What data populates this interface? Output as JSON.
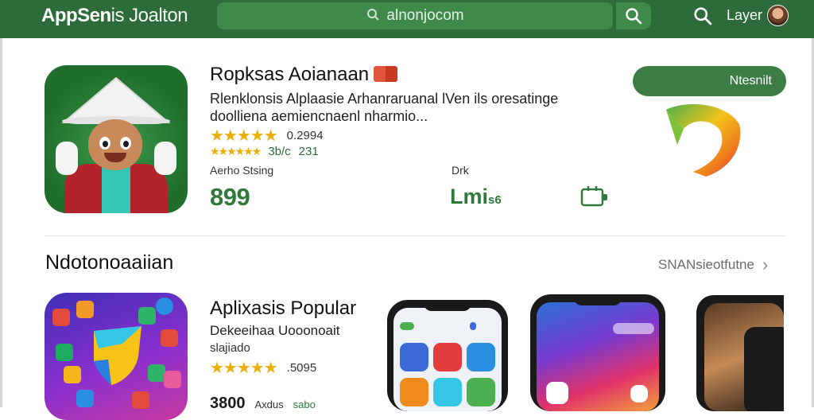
{
  "header": {
    "logo_bold": "AppSen",
    "logo_rest": "is Joalton",
    "search_text": "alnonjoc",
    "search_suffix": "om",
    "user_label": "Layer"
  },
  "featured": {
    "title": "Ropksas Aoianaan",
    "description": "Rlenklonsis Alplaasie Arhanraruanal lVen ils oresatinge doolliena aemiencnaenl nharmio...",
    "rating_text": "0.2994",
    "rating_count_a": "3b/c",
    "rating_count_b": "231",
    "size_label": "Aerho Stsing",
    "price": "899",
    "mid_label": "Drk",
    "mid_value_big": "Lmi",
    "mid_value_small": "s6",
    "install_label": "Ntesnilt"
  },
  "section": {
    "title": "Ndotonoaaiian",
    "see_all": "SNANsieotfutne"
  },
  "popular": {
    "title": "Aplixasis Popular",
    "description": "Dekeeihaa Uooonoait",
    "subtitle": "slajiado",
    "rating_text": ".5095",
    "price": "3800",
    "meta_a": "Axdus",
    "meta_b": "sabo"
  },
  "colors": {
    "topbar": "#2e6b3a",
    "accent_green": "#2f7a3a",
    "star": "#e8b007"
  }
}
